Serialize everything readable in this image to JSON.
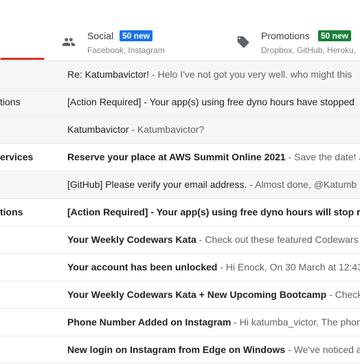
{
  "tabs": {
    "social": {
      "title": "Social",
      "badge": "50 new",
      "senders": "Facebook, Instagram",
      "icon": "people-icon"
    },
    "promotions": {
      "title": "Promotions",
      "badge": "50 new",
      "senders": "Dropbox, GitHub, Heroku,",
      "icon": "tag-icon"
    }
  },
  "emails": [
    {
      "sender": "",
      "subject": "Re: Katumbavictor!",
      "snippet": " - Helo I've not got you very well. who might this",
      "read": true
    },
    {
      "sender": "tions",
      "subject": "[Action Required] - Your app(s) using free dyno hours have stopped",
      "snippet": "",
      "read": true
    },
    {
      "sender": "",
      "subject": "Katumbavictor",
      "snippet": " - Katumbavictor?",
      "read": true
    },
    {
      "sender": "ervices",
      "subject": "Reserve your place at AWS Summit Online 2021",
      "snippet": " - Save the date! Jo",
      "read": false
    },
    {
      "sender": "",
      "subject": "[GitHub] Please verify your email address.",
      "snippet": " - Almost done, @Katumb",
      "read": true
    },
    {
      "sender": "tions",
      "subject": "[Action Required] - Your app(s) using free dyno hours will stop run",
      "snippet": "",
      "read": false
    },
    {
      "sender": "",
      "subject": "Your Weekly Codewars Kata",
      "snippet": " - Check out these featured Codewars k",
      "read": false
    },
    {
      "sender": "",
      "subject": "Your account has been unlocked",
      "snippet": " - Hi Enock, On 30 March at 12:43",
      "read": false
    },
    {
      "sender": "",
      "subject": "Your Weekly Codewars Kata + New Upcoming Bootcamp",
      "snippet": " - Check o",
      "read": false
    },
    {
      "sender": "",
      "subject": "Phone Number Added on Instagram",
      "snippet": " - Hi katumba_victor, The phone",
      "read": false
    },
    {
      "sender": "",
      "subject": "New login on Instagram from Edge on Windows",
      "snippet": " - We've noticed a n",
      "read": false
    }
  ]
}
